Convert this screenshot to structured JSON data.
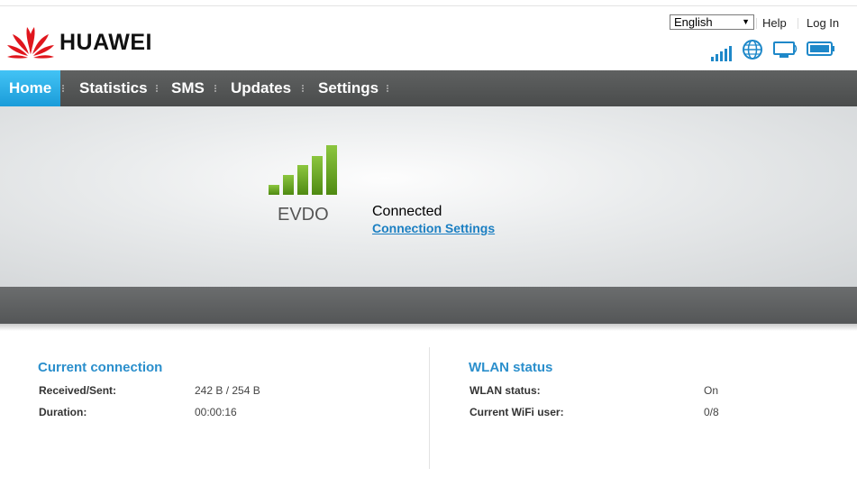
{
  "header": {
    "brand": "HUAWEI",
    "language": "English",
    "help_label": "Help",
    "login_label": "Log In",
    "status_icons": [
      "signal-strength-icon",
      "internet-globe-icon",
      "wifi-device-icon",
      "battery-icon"
    ]
  },
  "nav": {
    "tabs": [
      {
        "label": "Home",
        "active": true
      },
      {
        "label": "Statistics"
      },
      {
        "label": "SMS"
      },
      {
        "label": "Updates"
      },
      {
        "label": "Settings"
      }
    ]
  },
  "hero": {
    "network_type": "EVDO",
    "signal_bars": 5,
    "connection_status": "Connected",
    "connection_link": "Connection Settings"
  },
  "current_connection": {
    "title": "Current connection",
    "received_sent_label": "Received/Sent:",
    "received_sent_value": "242 B / 254 B",
    "duration_label": "Duration:",
    "duration_value": "00:00:16"
  },
  "wlan": {
    "title": "WLAN status",
    "status_label": "WLAN status:",
    "status_value": "On",
    "users_label": "Current WiFi user:",
    "users_value": "0/8"
  },
  "colors": {
    "accent": "#2b8fcc",
    "nav_bg": "#545656",
    "active_tab": "#2aaee8",
    "signal_green": "#6a9e1f",
    "brand_red": "#e0161d"
  }
}
